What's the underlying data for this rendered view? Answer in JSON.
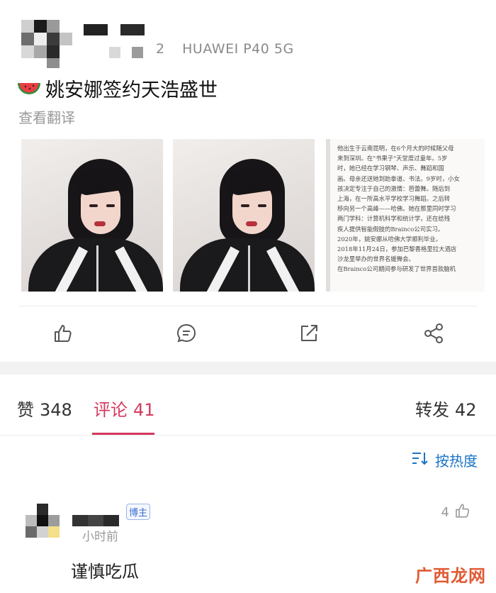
{
  "post": {
    "meta_count": "2",
    "device": "HUAWEI P40 5G",
    "title": "姚安娜签约天浩盛世",
    "translate": "查看翻译",
    "title_emoji": "watermelon-icon",
    "document_lines": [
      "他出生于云南昆明，在6个月大的时候随父母",
      "来到深圳。在\"书果子\"天堂度过童年。5岁",
      "时，她已经在学习钢琴、声乐、舞蹈和国",
      "画。母亲还送她到跆拳道、书法。9岁时，小女",
      "孩决定专注于自己的激情：芭蕾舞。随后到",
      "上海，在一所高水平学校学习舞蹈。之后转",
      "移向另一个高峰——哈佛。她在那里同时学习",
      "两门学科：计算机科学和统计学，还在给残",
      "疾人提供智能假肢的Brainco公司实习。",
      "2020年，姚安娜从哈佛大学顺利毕业。",
      "2018年11月24日，参加巴黎香格里拉大酒店",
      "沙龙里举办的世界名媛舞会。",
      "在Brainco公司期间参与研发了世界首款脑机"
    ]
  },
  "actions": {
    "like": "thumbs-up-icon",
    "comment": "comment-icon",
    "repost": "repost-icon",
    "share": "share-icon"
  },
  "tabs": [
    {
      "label": "赞",
      "count": "348"
    },
    {
      "label": "评论",
      "count": "41"
    },
    {
      "label": "转发",
      "count": "42"
    }
  ],
  "sort": {
    "label": "按热度",
    "icon": "sort-icon"
  },
  "comment": {
    "badge": "博主",
    "time": "小时前",
    "likes": "4",
    "text": "谨慎吃瓜"
  },
  "watermark": "广西龙网",
  "colors": {
    "accent": "#d4395f",
    "link": "#1a73c7",
    "muted": "#999999"
  }
}
